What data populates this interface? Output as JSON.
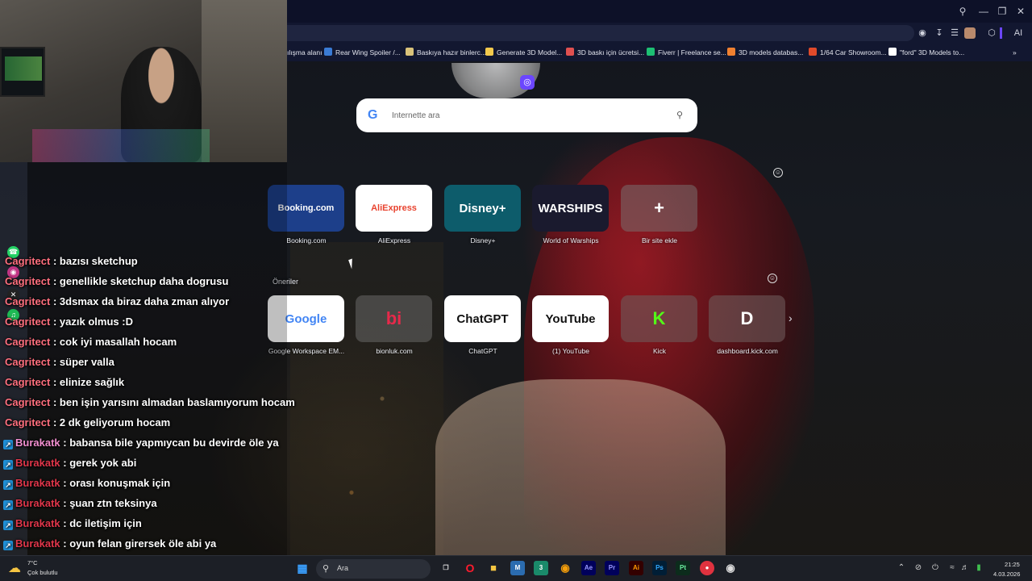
{
  "browser": {
    "bookmarks": [
      {
        "label": "ılışma alanı",
        "color": "#3a7bd5"
      },
      {
        "label": "Rear Wing Spoiler /...",
        "color": "#3a7bd5"
      },
      {
        "label": "Baskıya hazır binlerc...",
        "color": "#d9c27a"
      },
      {
        "label": "Generate 3D Model...",
        "color": "#f2c94c"
      },
      {
        "label": "3D baskı için ücretsi...",
        "color": "#e05050"
      },
      {
        "label": "Fiverr | Freelance se...",
        "color": "#1dbf73"
      },
      {
        "label": "3D models databas...",
        "color": "#f08030"
      },
      {
        "label": "1/64 Car Showroom...",
        "color": "#e04a2a"
      },
      {
        "label": "\"ford\" 3D Models to...",
        "color": "#ffffff"
      }
    ],
    "ai_label": "AI"
  },
  "search": {
    "placeholder": "İnternette ara"
  },
  "speed_dial": [
    {
      "label": "Booking.com",
      "logo": "Booking.com",
      "bg": "#1d3f8a",
      "fg": "#ffffff"
    },
    {
      "label": "AliExpress",
      "logo": "AliExpress",
      "bg": "#ffffff",
      "fg": "#e8432f"
    },
    {
      "label": "Disney+",
      "logo": "Disney+",
      "bg": "#0d5c6b",
      "fg": "#ffffff"
    },
    {
      "label": "World of Warships",
      "logo": "WARSHIPS",
      "bg": "#1a1a2e",
      "fg": "#ffffff"
    },
    {
      "label": "Bir site ekle",
      "logo": "+",
      "bg": "rgba(120,110,110,0.55)",
      "fg": "#ffffff"
    }
  ],
  "suggestions_label": "Öneriler",
  "suggestions": [
    {
      "label": "Google Workspace EM...",
      "logo": "Google",
      "bg": "#ffffff",
      "fg": "#4285f4"
    },
    {
      "label": "bionluk.com",
      "logo": "bi",
      "bg": "rgba(120,120,120,0.45)",
      "fg": "#e6294a"
    },
    {
      "label": "ChatGPT",
      "logo": "ChatGPT",
      "bg": "#ffffff",
      "fg": "#111111"
    },
    {
      "label": "(1) YouTube",
      "logo": "YouTube",
      "bg": "#ffffff",
      "fg": "#111111"
    },
    {
      "label": "Kick",
      "logo": "K",
      "bg": "rgba(110,90,90,0.6)",
      "fg": "#53fc18"
    },
    {
      "label": "dashboard.kick.com",
      "logo": "D",
      "bg": "rgba(110,90,90,0.6)",
      "fg": "#ffffff"
    }
  ],
  "chat": [
    {
      "user": "Cagritect",
      "msg": ": bazısı sketchup",
      "badge": false,
      "style": "ct"
    },
    {
      "user": "Cagritect",
      "msg": ": genellikle sketchup daha dogrusu",
      "badge": false,
      "style": "ct"
    },
    {
      "user": "Cagritect",
      "msg": ": 3dsmax da biraz daha zman alıyor",
      "badge": false,
      "style": "ct"
    },
    {
      "user": "Cagritect",
      "msg": ": yazık olmus :D",
      "badge": false,
      "style": "ct"
    },
    {
      "user": "Cagritect",
      "msg": ": cok iyi masallah hocam",
      "badge": false,
      "style": "ct"
    },
    {
      "user": "Cagritect",
      "msg": ": süper valla",
      "badge": false,
      "style": "ct"
    },
    {
      "user": "Cagritect",
      "msg": ": elinize sağlık",
      "badge": false,
      "style": "ct"
    },
    {
      "user": "Cagritect",
      "msg": ": ben işin yarısını almadan baslamıyorum hocam",
      "badge": false,
      "style": "ct"
    },
    {
      "user": "Cagritect",
      "msg": ": 2 dk geliyorum hocam",
      "badge": false,
      "style": "ct"
    },
    {
      "user": "Burakatk",
      "msg": ": babansa bile yapmıycan bu devirde öle ya",
      "badge": true,
      "style": "bk1"
    },
    {
      "user": "Burakatk",
      "msg": ": gerek yok abi",
      "badge": true,
      "style": "bk"
    },
    {
      "user": "Burakatk",
      "msg": ": orası konuşmak için",
      "badge": true,
      "style": "bk"
    },
    {
      "user": "Burakatk",
      "msg": ": şuan ztn teksinya",
      "badge": true,
      "style": "bk"
    },
    {
      "user": "Burakatk",
      "msg": ": dc iletişim için",
      "badge": true,
      "style": "bk"
    },
    {
      "user": "Burakatk",
      "msg": ": oyun felan girersek öle abi ya",
      "badge": true,
      "style": "bk"
    }
  ],
  "taskbar": {
    "temperature": "7°C",
    "condition": "Çok bulutlu",
    "search_label": "Ara",
    "apps": [
      {
        "name": "ae",
        "label": "Ae",
        "bg": "#00005b",
        "fg": "#9999ff"
      },
      {
        "name": "pr",
        "label": "Pr",
        "bg": "#00005b",
        "fg": "#9999ff"
      },
      {
        "name": "ai",
        "label": "Ai",
        "bg": "#330000",
        "fg": "#ff9a00"
      },
      {
        "name": "ps",
        "label": "Ps",
        "bg": "#001e36",
        "fg": "#31a8ff"
      },
      {
        "name": "pt",
        "label": "Pt",
        "bg": "#0c2c1c",
        "fg": "#6cf2a0"
      }
    ],
    "time": "21:25",
    "date": "4.03.2026"
  }
}
